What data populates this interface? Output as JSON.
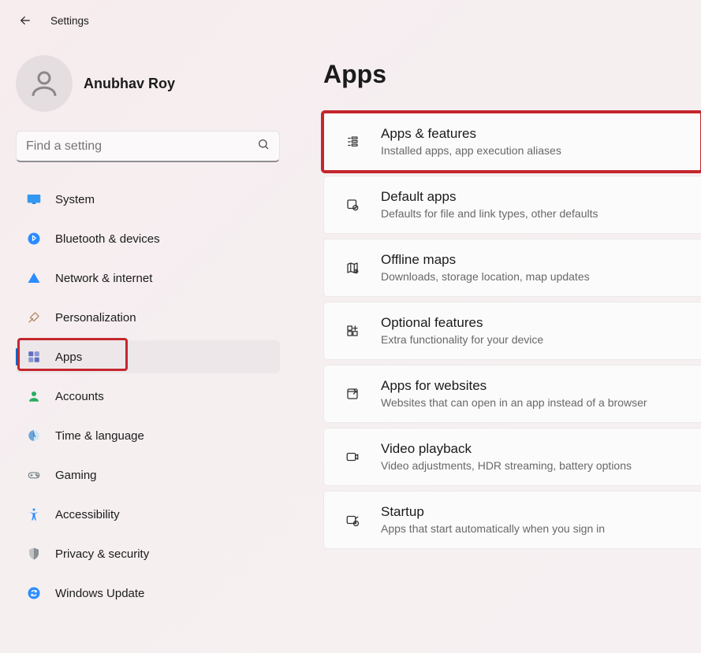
{
  "window": {
    "title": "Settings"
  },
  "account": {
    "username": "Anubhav Roy"
  },
  "search": {
    "placeholder": "Find a setting"
  },
  "page": {
    "heading": "Apps"
  },
  "nav": {
    "items": [
      {
        "label": "System",
        "icon": "monitor-icon",
        "color": "#3498f3"
      },
      {
        "label": "Bluetooth & devices",
        "icon": "bluetooth-icon",
        "color": "#3385ff"
      },
      {
        "label": "Network & internet",
        "icon": "wifi-icon",
        "color": "#2c8cff"
      },
      {
        "label": "Personalization",
        "icon": "paintbrush-icon",
        "color": "#b58a66"
      },
      {
        "label": "Apps",
        "icon": "apps-icon",
        "color": "#5f6fc1",
        "active": true
      },
      {
        "label": "Accounts",
        "icon": "person-icon",
        "color": "#27ae60"
      },
      {
        "label": "Time & language",
        "icon": "clock-globe-icon",
        "color": "#6da6d9"
      },
      {
        "label": "Gaming",
        "icon": "gamepad-icon",
        "color": "#7f8c8d"
      },
      {
        "label": "Accessibility",
        "icon": "accessibility-icon",
        "color": "#2c8cff"
      },
      {
        "label": "Privacy & security",
        "icon": "shield-icon",
        "color": "#8a8f93"
      },
      {
        "label": "Windows Update",
        "icon": "sync-icon",
        "color": "#2c8cff"
      }
    ]
  },
  "cards": [
    {
      "title": "Apps & features",
      "sub": "Installed apps, app execution aliases",
      "icon": "apps-features-icon",
      "highlighted": true
    },
    {
      "title": "Default apps",
      "sub": "Defaults for file and link types, other defaults",
      "icon": "default-apps-icon"
    },
    {
      "title": "Offline maps",
      "sub": "Downloads, storage location, map updates",
      "icon": "offline-maps-icon"
    },
    {
      "title": "Optional features",
      "sub": "Extra functionality for your device",
      "icon": "optional-features-icon"
    },
    {
      "title": "Apps for websites",
      "sub": "Websites that can open in an app instead of a browser",
      "icon": "apps-websites-icon"
    },
    {
      "title": "Video playback",
      "sub": "Video adjustments, HDR streaming, battery options",
      "icon": "video-playback-icon"
    },
    {
      "title": "Startup",
      "sub": "Apps that start automatically when you sign in",
      "icon": "startup-icon"
    }
  ]
}
